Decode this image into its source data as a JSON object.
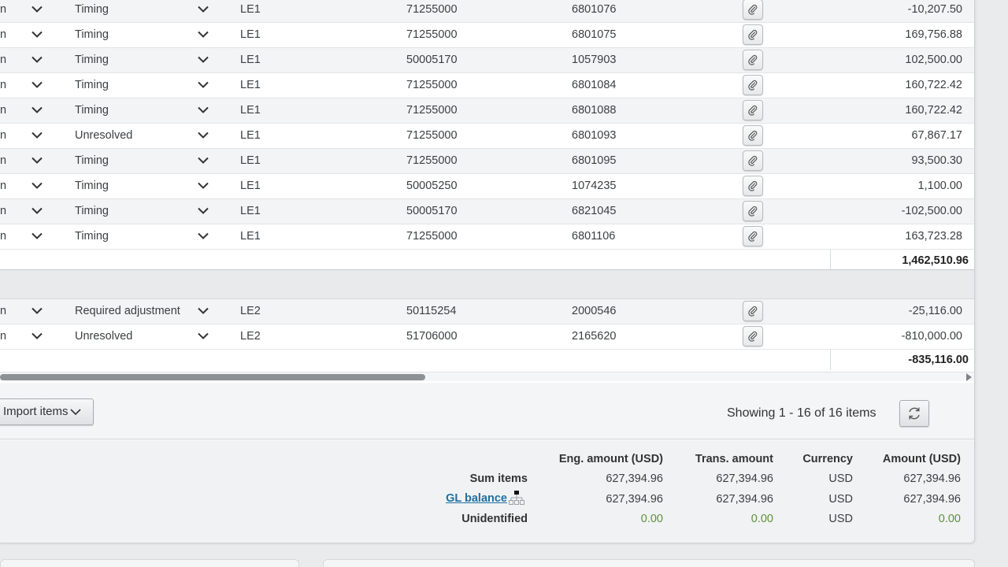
{
  "grid": {
    "group1_rows": [
      {
        "type": "Timing",
        "le": "LE1",
        "account": "71255000",
        "document": "6801076",
        "amount": "-10,207.50"
      },
      {
        "type": "Timing",
        "le": "LE1",
        "account": "71255000",
        "document": "6801075",
        "amount": "169,756.88"
      },
      {
        "type": "Timing",
        "le": "LE1",
        "account": "50005170",
        "document": "1057903",
        "amount": "102,500.00"
      },
      {
        "type": "Timing",
        "le": "LE1",
        "account": "71255000",
        "document": "6801084",
        "amount": "160,722.42"
      },
      {
        "type": "Timing",
        "le": "LE1",
        "account": "71255000",
        "document": "6801088",
        "amount": "160,722.42"
      },
      {
        "type": "Unresolved",
        "le": "LE1",
        "account": "71255000",
        "document": "6801093",
        "amount": "67,867.17"
      },
      {
        "type": "Timing",
        "le": "LE1",
        "account": "71255000",
        "document": "6801095",
        "amount": "93,500.30"
      },
      {
        "type": "Timing",
        "le": "LE1",
        "account": "50005250",
        "document": "1074235",
        "amount": "1,100.00"
      },
      {
        "type": "Timing",
        "le": "LE1",
        "account": "50005170",
        "document": "6821045",
        "amount": "-102,500.00"
      },
      {
        "type": "Timing",
        "le": "LE1",
        "account": "71255000",
        "document": "6801106",
        "amount": "163,723.28"
      }
    ],
    "group1_total": "1,462,510.96",
    "group2_rows": [
      {
        "type": "Required adjustment",
        "le": "LE2",
        "account": "50115254",
        "document": "2000546",
        "amount": "-25,116.00"
      },
      {
        "type": "Unresolved",
        "le": "LE2",
        "account": "51706000",
        "document": "2165620",
        "amount": "-810,000.00"
      }
    ],
    "group2_total": "-835,116.00",
    "truncated_cell": "n"
  },
  "toolbar": {
    "import_label": "Import items",
    "showing_text": "Showing 1 - 16 of 16 items"
  },
  "summary": {
    "headers": {
      "eng_amount": "Eng. amount (USD)",
      "trans_amount": "Trans. amount",
      "currency": "Currency",
      "amount": "Amount (USD)"
    },
    "rows": [
      {
        "label": "Sum items",
        "eng": "627,394.96",
        "trans": "627,394.96",
        "currency": "USD",
        "amount": "627,394.96"
      },
      {
        "label": "GL balance",
        "eng": "627,394.96",
        "trans": "627,394.96",
        "currency": "USD",
        "amount": "627,394.96"
      },
      {
        "label": "Unidentified",
        "eng": "0.00",
        "trans": "0.00",
        "currency": "USD",
        "amount": "0.00"
      }
    ]
  },
  "colors": {
    "link": "#1f6fa1",
    "zero_value": "#5e8f3e",
    "row_alt": "#f3f4f5"
  },
  "icons": {
    "row_dropdown": "chevron-down-icon",
    "attachment": "paperclip-icon",
    "refresh": "refresh-icon",
    "hierarchy": "hierarchy-icon"
  }
}
